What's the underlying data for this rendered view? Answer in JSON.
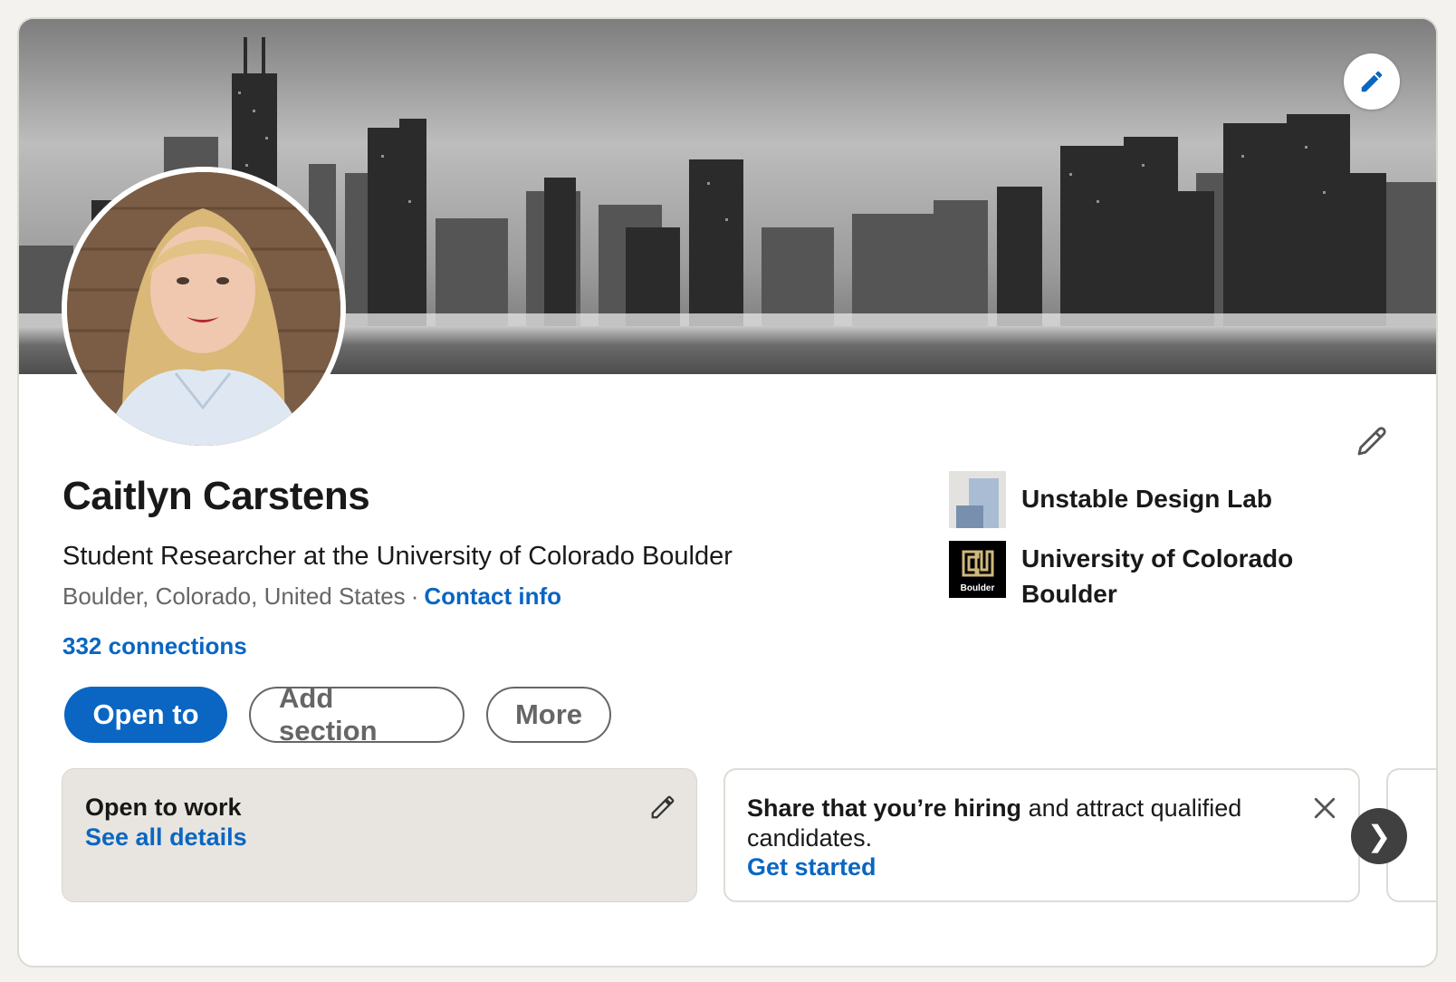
{
  "profile": {
    "name": "Caitlyn Carstens",
    "headline": "Student Researcher at the University of Colorado Boulder",
    "location": "Boulder, Colorado, United States",
    "separator": "·",
    "contact_info": "Contact info",
    "connections": "332 connections"
  },
  "actions": {
    "open_to": "Open to",
    "add_section": "Add section",
    "more": "More"
  },
  "organizations": [
    {
      "name": "Unstable Design Lab",
      "icon": "unstable-design-lab-logo"
    },
    {
      "name": "University of Colorado Boulder",
      "icon": "cu-boulder-logo",
      "logo_text": "Boulder"
    }
  ],
  "open_to_work": {
    "title": "Open to work",
    "link": "See all details"
  },
  "hiring": {
    "bold": "Share that you’re hiring",
    "rest": " and attract qualified candidates.",
    "link": "Get started"
  },
  "carousel": {
    "next_glyph": "❯"
  },
  "colors": {
    "accent": "#0a66c2",
    "page_bg": "#f3f2ef",
    "card_bg": "#ffffff",
    "muted_text": "#666666",
    "otw_bg": "#e8e5e0",
    "cu_gold": "#cfb87c"
  },
  "icons": {
    "banner_edit": "pencil-icon",
    "intro_edit": "pencil-icon",
    "otw_edit": "pencil-icon",
    "hire_close": "close-icon",
    "next": "chevron-right-icon"
  }
}
